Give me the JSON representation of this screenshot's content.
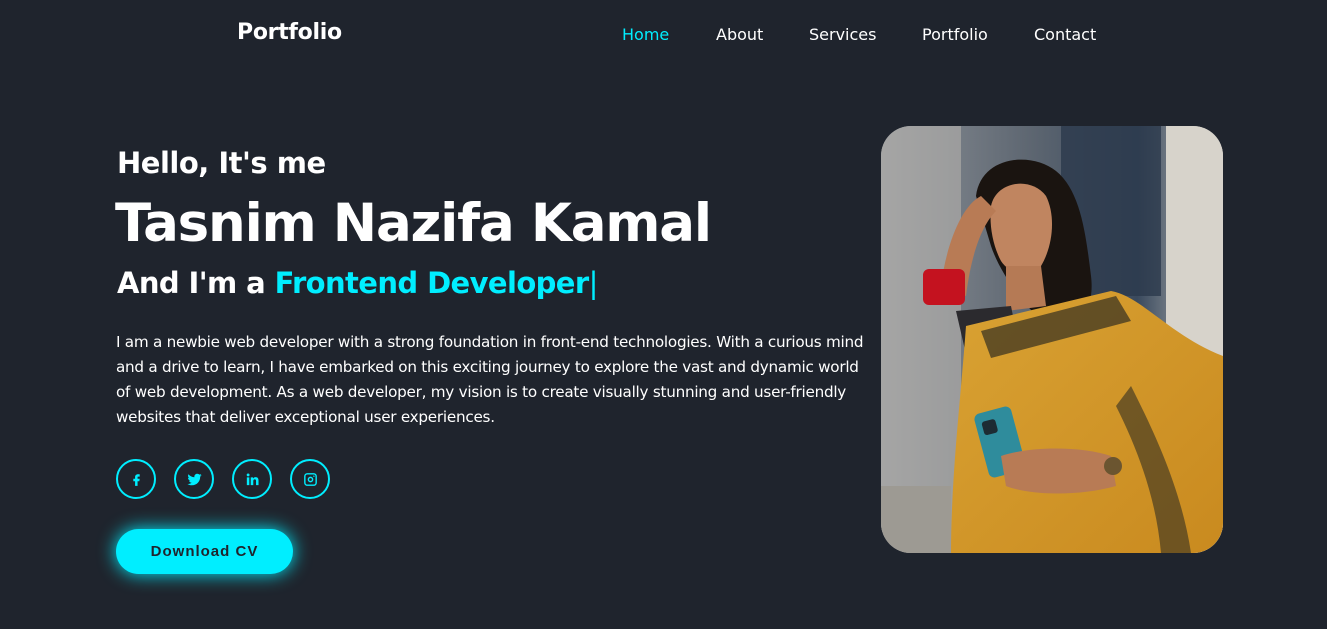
{
  "header": {
    "logo": "Portfolio",
    "nav": [
      "Home",
      "About",
      "Services",
      "Portfolio",
      "Contact"
    ]
  },
  "hero": {
    "greeting": "Hello, It's me",
    "name": "Tasnim Nazifa Kamal",
    "role_prefix": "And I'm a",
    "role": "Frontend Developer",
    "cursor": "|",
    "bio": "I am a newbie web developer with a strong foundation in front-end technologies. With a curious mind and a drive to learn, I have embarked on this exciting journey to explore the vast and dynamic world of web development. As a web developer, my vision is to create visually stunning and user-friendly websites that deliver exceptional user experiences.",
    "cv_button": "Download CV"
  },
  "social": [
    "facebook-icon",
    "twitter-icon",
    "linkedin-icon",
    "instagram-icon"
  ],
  "colors": {
    "background": "#1f242d",
    "accent": "#00eeff",
    "text": "#ffffff"
  }
}
